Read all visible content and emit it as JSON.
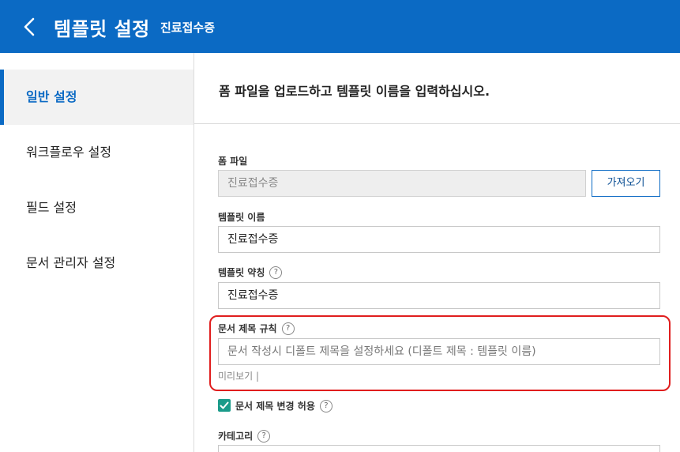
{
  "header": {
    "title": "템플릿 설정",
    "subtitle": "진료접수증",
    "back_icon": "chevron-left-icon",
    "background": "#0b6ac4"
  },
  "sidebar": {
    "items": [
      {
        "label": "일반 설정",
        "active": true
      },
      {
        "label": "워크플로우 설정",
        "active": false
      },
      {
        "label": "필드 설정",
        "active": false
      },
      {
        "label": "문서 관리자 설정",
        "active": false
      }
    ]
  },
  "main": {
    "instruction": "폼 파일을 업로드하고 템플릿 이름을 입력하십시오.",
    "form_file": {
      "label": "폼 파일",
      "value": "진료접수증",
      "import_button": "가져오기"
    },
    "template_name": {
      "label": "템플릿 이름",
      "value": "진료접수증"
    },
    "template_abbr": {
      "label": "템플릿 약칭",
      "help": "?",
      "value": "진료접수증"
    },
    "doc_title_rule": {
      "label": "문서 제목 규칙",
      "help": "?",
      "placeholder": "문서 작성시 디폴트 제목을 설정하세요 (디폴트 제목 : 템플릿 이름)",
      "preview": "미리보기 |",
      "highlight_color": "#e01e1e"
    },
    "allow_title_change": {
      "label": "문서 제목 변경 허용",
      "help": "?",
      "checked": true,
      "check_color": "#1a9b8a"
    },
    "category": {
      "label": "카테고리",
      "help": "?"
    }
  }
}
